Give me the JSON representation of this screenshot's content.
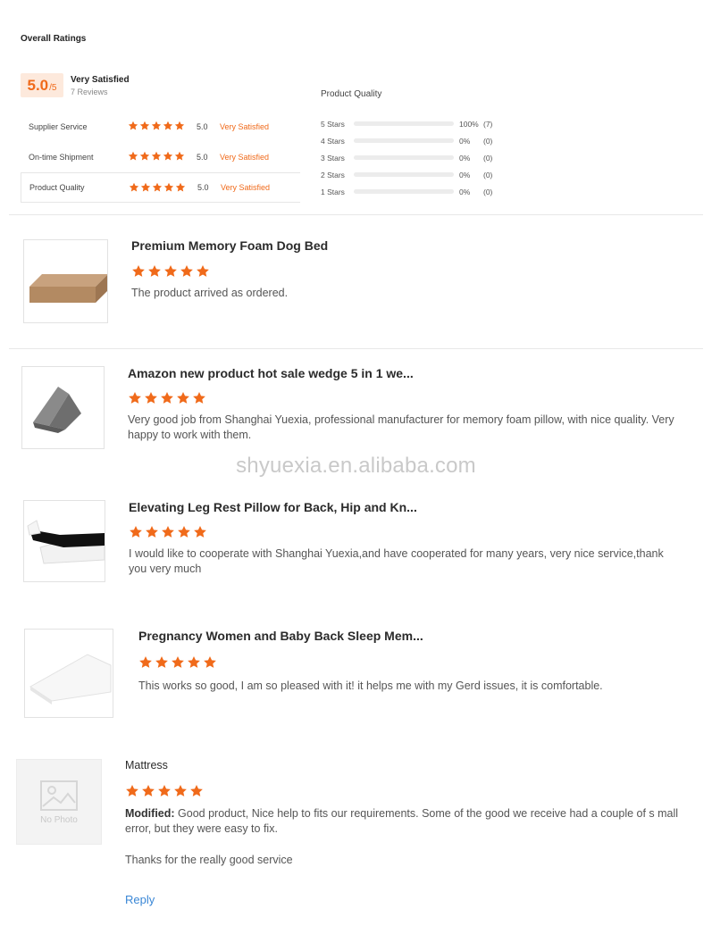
{
  "overall": {
    "title": "Overall Ratings",
    "score": "5.0",
    "score_max": "/5",
    "summary_label": "Very Satisfied",
    "review_count": "7 Reviews",
    "categories": [
      {
        "label": "Supplier Service",
        "score": "5.0",
        "text": "Very Satisfied",
        "stars": 5
      },
      {
        "label": "On-time Shipment",
        "score": "5.0",
        "text": "Very Satisfied",
        "stars": 5
      },
      {
        "label": "Product Quality",
        "score": "5.0",
        "text": "Very Satisfied",
        "stars": 5
      }
    ]
  },
  "product_quality": {
    "title": "Product Quality",
    "rows": [
      {
        "label": "5 Stars",
        "percent": "100%",
        "count": "(7)",
        "fraction": 1.0
      },
      {
        "label": "4 Stars",
        "percent": "0%",
        "count": "(0)",
        "fraction": 0
      },
      {
        "label": "3 Stars",
        "percent": "0%",
        "count": "(0)",
        "fraction": 0
      },
      {
        "label": "2 Stars",
        "percent": "0%",
        "count": "(0)",
        "fraction": 0
      },
      {
        "label": "1 Stars",
        "percent": "0%",
        "count": "(0)",
        "fraction": 0
      }
    ]
  },
  "reviews": [
    {
      "title": "Premium Memory Foam Dog Bed",
      "stars": 5,
      "text": "The product arrived as ordered."
    },
    {
      "title": "Amazon new product hot sale wedge 5 in 1 we...",
      "stars": 5,
      "text": "Very good job from Shanghai Yuexia, professional manufacturer for memory foam pillow, with nice quality. Very happy to work with them."
    },
    {
      "title": "Elevating Leg Rest Pillow for Back, Hip and Kn...",
      "stars": 5,
      "text": "I would like to cooperate with Shanghai Yuexia,and have cooperated for many years, very nice service,thank you very much"
    },
    {
      "title": "Pregnancy Women and Baby Back Sleep Mem...",
      "stars": 5,
      "text": "This works so good, I am so pleased with it! it helps me with my Gerd issues, it is comfortable."
    },
    {
      "title": "Mattress",
      "stars": 5,
      "modified_label": "Modified:",
      "text": "Good product, Nice help to fits our requirements. Some of the good we receive had a couple of s mall error, but they were easy to fix.",
      "extra_text": "Thanks for the really good service",
      "reply_label": "Reply",
      "no_photo_label": "No Photo"
    }
  ],
  "watermark": "shyuexia.en.alibaba.com",
  "colors": {
    "accent": "#f06a1a",
    "link": "#3a87d6"
  }
}
